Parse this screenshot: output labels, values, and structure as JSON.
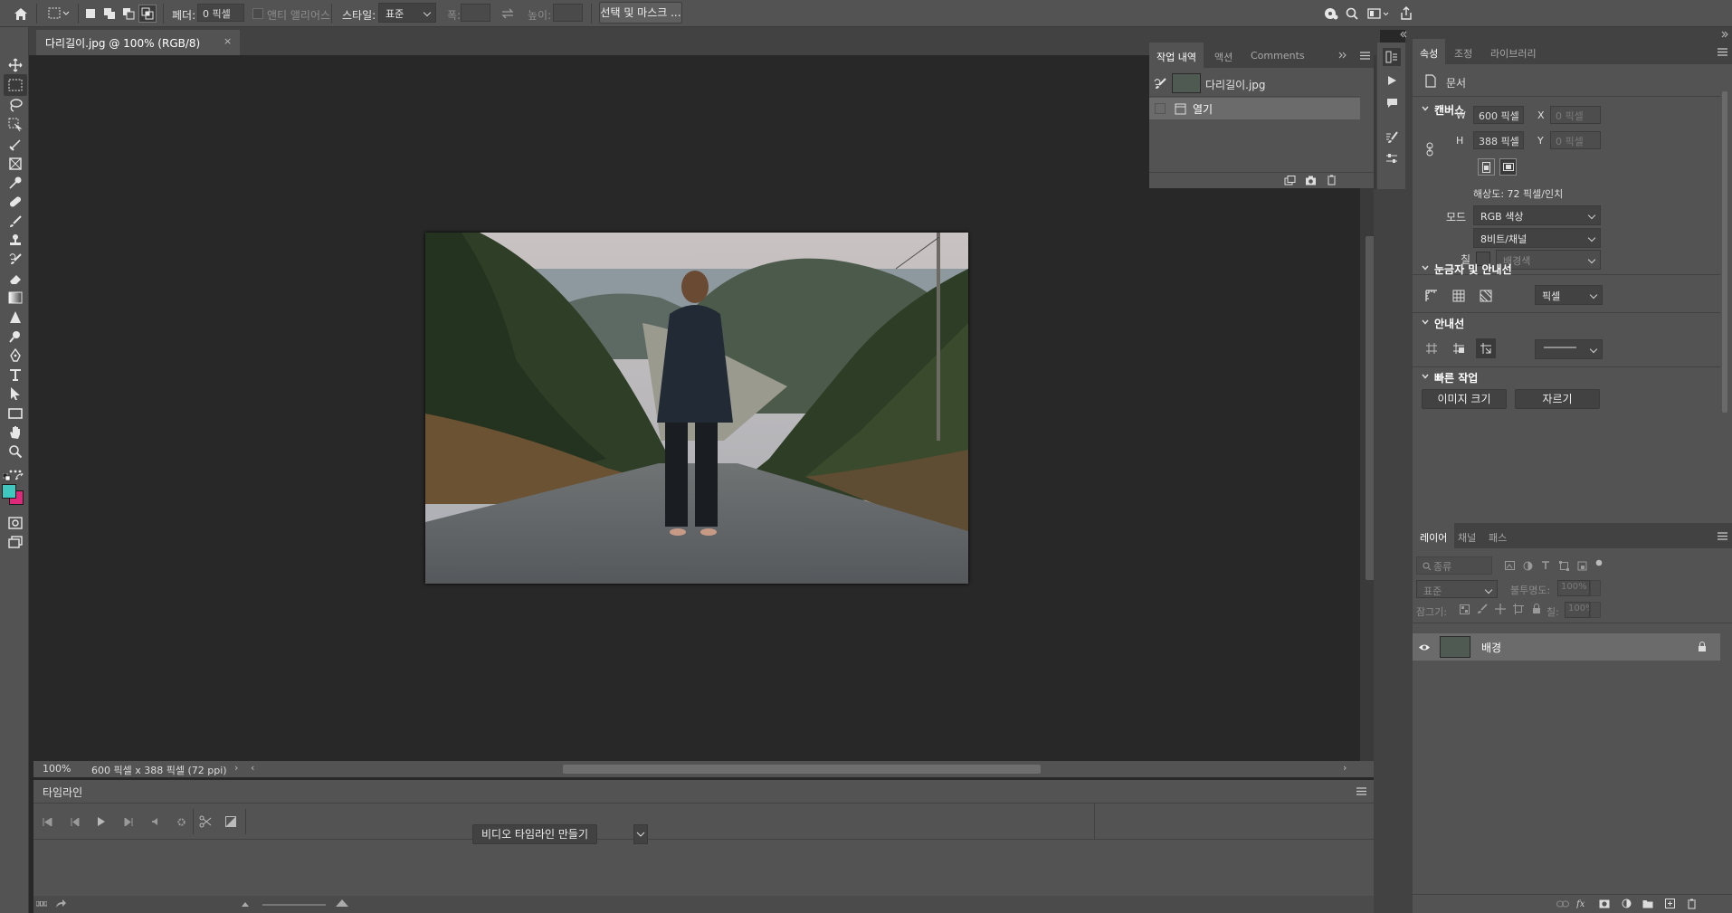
{
  "options_bar": {
    "feather_label": "페더:",
    "feather_value": "0 픽셀",
    "antialias_label": "앤티 앨리어스",
    "style_label": "스타일:",
    "style_value": "표준",
    "width_label": "폭:",
    "height_label": "높이:",
    "select_mask_button": "선택 및 마스크 ..."
  },
  "document": {
    "tab_title": "다리길이.jpg @ 100% (RGB/8)",
    "zoom": "100%",
    "doc_info": "600 픽셀 x 388 픽셀 (72 ppi)"
  },
  "history_panel": {
    "tabs": [
      "작업 내역",
      "액션",
      "Comments"
    ],
    "snapshot_name": "다리길이.jpg",
    "steps": [
      "열기"
    ]
  },
  "properties_panel": {
    "tabs": [
      "속성",
      "조정",
      "라이브러리"
    ],
    "doc_type": "문서",
    "canvas_section": "캔버스",
    "w_label": "W",
    "w_value": "600 픽셀",
    "h_label": "H",
    "h_value": "388 픽셀",
    "x_label": "X",
    "x_value": "0 픽셀",
    "y_label": "Y",
    "y_value": "0 픽셀",
    "resolution": "해상도: 72 픽셀/인치",
    "mode_label": "모드",
    "mode_value": "RGB 색상",
    "depth_value": "8비트/채널",
    "fill_label": "칠",
    "fill_value": "배경색",
    "rulers_section": "눈금자 및 안내선",
    "units_value": "픽셀",
    "guides_section": "안내선",
    "quick_actions_section": "빠른 작업",
    "image_size_button": "이미지 크기",
    "crop_button": "자르기"
  },
  "layers_panel": {
    "tabs": [
      "레이어",
      "채널",
      "패스"
    ],
    "filter_placeholder": "종류",
    "blend_mode": "표준",
    "opacity_label": "불투명도:",
    "opacity_value": "100%",
    "lock_label": "잠그기:",
    "fill_label": "칠:",
    "fill_value": "100%",
    "layer_name": "배경"
  },
  "timeline_panel": {
    "title": "타임라인",
    "create_button": "비디오 타임라인 만들기"
  },
  "colors": {
    "foreground": "#3fc8c0",
    "background": "#e0287a"
  }
}
